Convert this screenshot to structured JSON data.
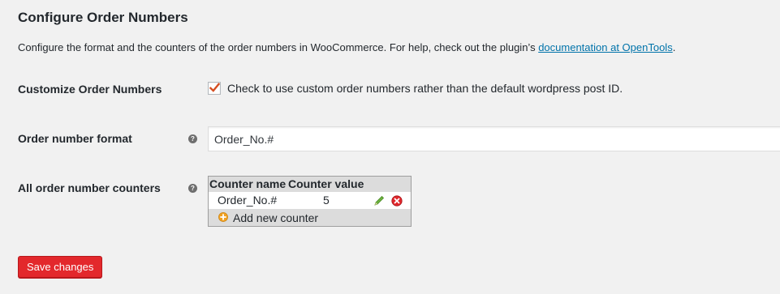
{
  "page": {
    "title": "Configure Order Numbers",
    "intro_text": "Configure the format and the counters of the order numbers in WooCommerce. For help, check out the plugin’s ",
    "intro_link": "documentation at OpenTools",
    "intro_end": "."
  },
  "customize": {
    "label": "Customize Order Numbers",
    "checked": true,
    "checkbox_label": "Check to use custom order numbers rather than the default wordpress post ID."
  },
  "format": {
    "label": "Order number format",
    "value": "Order_No.#",
    "help_icon": "question-circle-icon"
  },
  "counters": {
    "label": "All order number counters",
    "help_icon": "question-circle-icon",
    "columns": [
      "Counter name",
      "Counter value"
    ],
    "rows": [
      {
        "name": "Order_No.#",
        "value": "5"
      }
    ],
    "add_label": "Add new counter"
  },
  "actions": {
    "save_label": "Save changes"
  },
  "colors": {
    "link": "#0073aa",
    "save_button": "#e3282c",
    "checkmark": "#d54e21",
    "edit_icon": "#5fa531",
    "delete_icon": "#e0262b",
    "add_icon": "#f0a020"
  }
}
